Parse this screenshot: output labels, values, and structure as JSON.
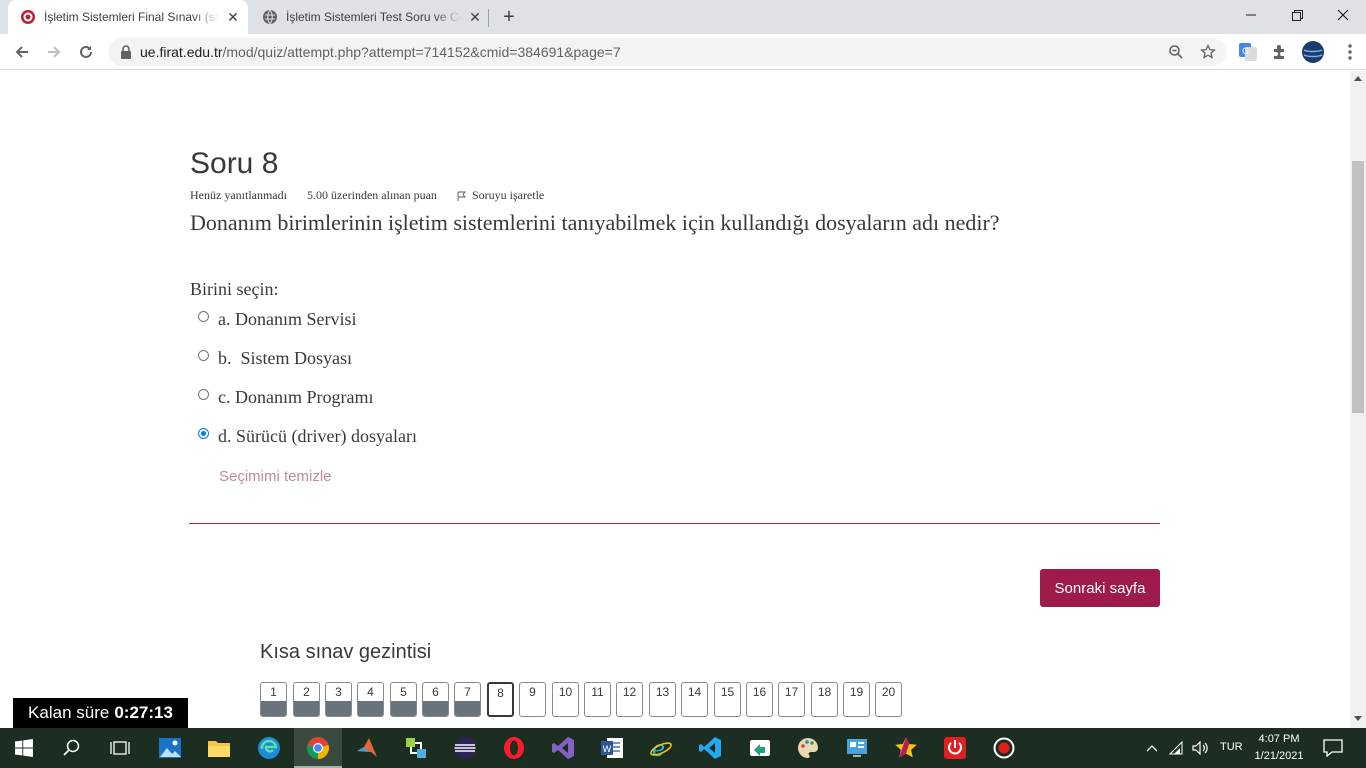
{
  "browser": {
    "tabs": [
      {
        "title": "İşletim Sistemleri Final Sınavı (say",
        "active": true
      },
      {
        "title": "İşletim Sistemleri Test Soru ve Ce",
        "active": false
      }
    ],
    "new_tab": "+",
    "url_host": "ue.firat.edu.tr",
    "url_path": "/mod/quiz/attempt.php?attempt=714152&cmid=384691&page=7"
  },
  "question": {
    "heading": "Soru 8",
    "status": "Henüz yanıtlanmadı",
    "grade": "5.00 üzerinden alınan puan",
    "flag_label": "Soruyu işaretle",
    "text": "Donanım birimlerinin işletim sistemlerini tanıyabilmek için kullandığı dosyaların adı nedir?",
    "prompt": "Birini seçin:",
    "options": [
      {
        "label": "a. Donanım Servisi",
        "checked": false
      },
      {
        "label": "b.  Sistem Dosyası",
        "checked": false
      },
      {
        "label": "c. Donanım Programı",
        "checked": false
      },
      {
        "label": "d. Sürücü (driver) dosyaları",
        "checked": true
      }
    ],
    "clear_choice": "Seçimimi temizle"
  },
  "next_button": "Sonraki sayfa",
  "quiz_nav": {
    "heading": "Kısa sınav gezintisi",
    "pages": [
      {
        "n": "1",
        "state": "answered"
      },
      {
        "n": "2",
        "state": "answered"
      },
      {
        "n": "3",
        "state": "answered"
      },
      {
        "n": "4",
        "state": "answered"
      },
      {
        "n": "5",
        "state": "answered"
      },
      {
        "n": "6",
        "state": "answered"
      },
      {
        "n": "7",
        "state": "answered"
      },
      {
        "n": "8",
        "state": "current"
      },
      {
        "n": "9",
        "state": "empty"
      },
      {
        "n": "10",
        "state": "empty"
      },
      {
        "n": "11",
        "state": "empty"
      },
      {
        "n": "12",
        "state": "empty"
      },
      {
        "n": "13",
        "state": "empty"
      },
      {
        "n": "14",
        "state": "empty"
      },
      {
        "n": "15",
        "state": "empty"
      },
      {
        "n": "16",
        "state": "empty"
      },
      {
        "n": "17",
        "state": "empty"
      },
      {
        "n": "18",
        "state": "empty"
      },
      {
        "n": "19",
        "state": "empty"
      },
      {
        "n": "20",
        "state": "empty"
      }
    ]
  },
  "timer": {
    "label": "Kalan süre",
    "value": "0:27:13"
  },
  "taskbar": {
    "language": "TUR",
    "time": "4:07 PM",
    "date": "1/21/2021"
  },
  "colors": {
    "accent": "#9e1b4c",
    "divider": "#8c2a4f",
    "taskbar": "#1c2e22"
  }
}
